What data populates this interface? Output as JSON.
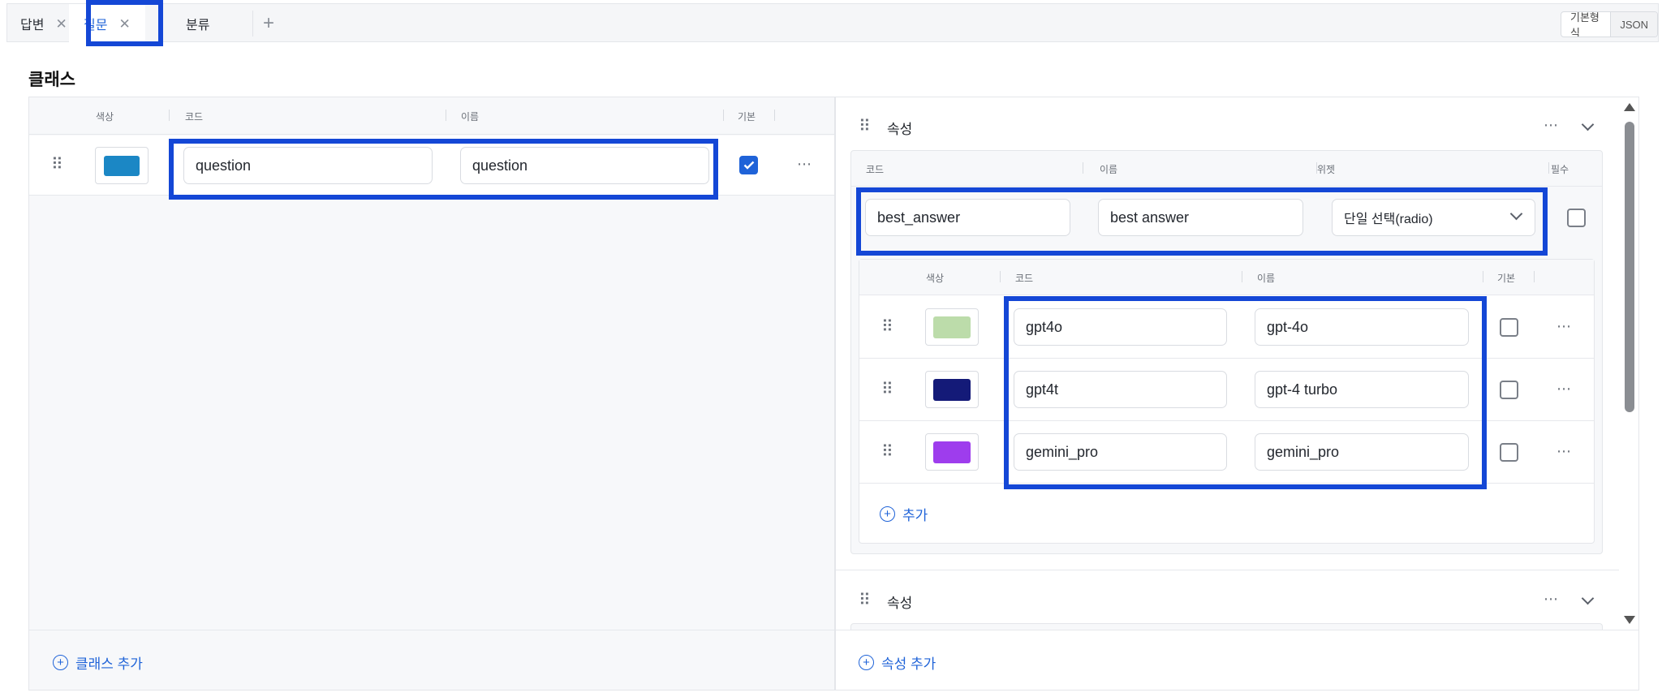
{
  "tabs": [
    {
      "label": "답변"
    },
    {
      "label": "질문"
    },
    {
      "label": "분류"
    }
  ],
  "view_mode": {
    "basic": "기본형식",
    "json": "JSON"
  },
  "section_title": "클래스",
  "class_table": {
    "headers": {
      "color": "색상",
      "code": "코드",
      "name": "이름",
      "default": "기본"
    },
    "rows": [
      {
        "color": "#1b87c5",
        "code": "question",
        "name": "question",
        "default": true
      }
    ],
    "add_label": "클래스 추가"
  },
  "attributes": [
    {
      "title": "속성",
      "headers": {
        "code": "코드",
        "name": "이름",
        "widget": "위젯",
        "required": "필수"
      },
      "code": "best_answer",
      "name": "best answer",
      "widget": "단일 선택(radio)",
      "required": false,
      "options": {
        "headers": {
          "color": "색상",
          "code": "코드",
          "name": "이름",
          "default": "기본"
        },
        "rows": [
          {
            "color": "#bcdcaa",
            "code": "gpt4o",
            "name": "gpt-4o",
            "default": false
          },
          {
            "color": "#141a78",
            "code": "gpt4t",
            "name": "gpt-4 turbo",
            "default": false
          },
          {
            "color": "#9e3ded",
            "code": "gemini_pro",
            "name": "gemini_pro",
            "default": false
          }
        ],
        "add_label": "추가"
      }
    },
    {
      "title": "속성"
    }
  ],
  "add_attribute_label": "속성 추가"
}
